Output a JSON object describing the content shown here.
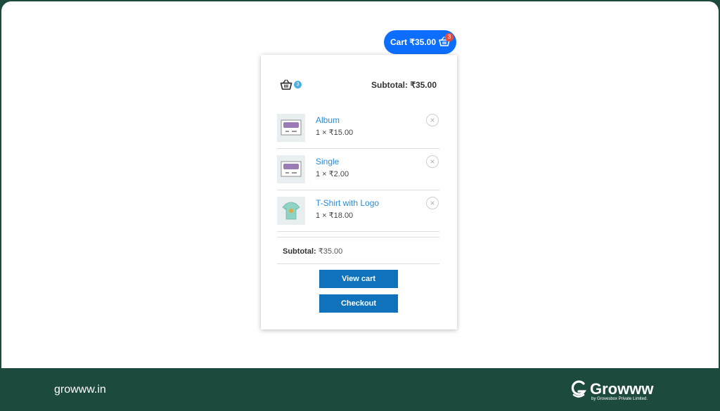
{
  "cart_pill": {
    "label": "Cart ₹35.00",
    "badge": "3"
  },
  "popup": {
    "header_badge": "3",
    "header_subtotal": "Subtotal: ₹35.00",
    "items": [
      {
        "name": "Album",
        "qty": "1 × ₹15.00",
        "remove": "×"
      },
      {
        "name": "Single",
        "qty": "1 × ₹2.00",
        "remove": "×"
      },
      {
        "name": "T-Shirt with Logo",
        "qty": "1 × ₹18.00",
        "remove": "×"
      }
    ],
    "footer_subtotal_label": "Subtotal:",
    "footer_subtotal_value": "₹35.00",
    "view_cart_label": "View cart",
    "checkout_label": "Checkout"
  },
  "footer": {
    "url": "growww.in",
    "brand_name": "Growww",
    "brand_tagline": "by Grovesbox Private Limited."
  },
  "colors": {
    "accent": "#0d6efd",
    "button": "#0f72bb",
    "link": "#2b8ad6",
    "footer_bg": "#1d4a3f"
  }
}
